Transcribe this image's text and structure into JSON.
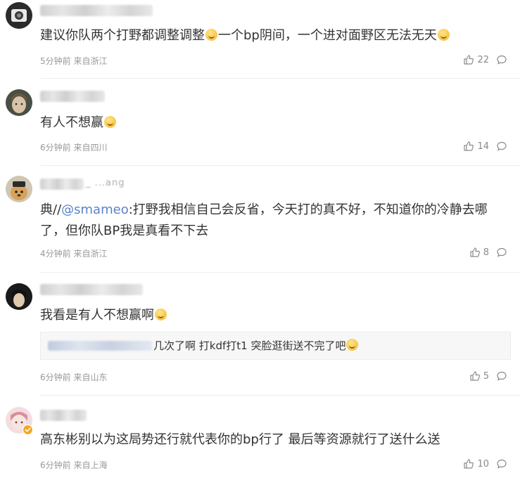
{
  "comments": [
    {
      "name_visible": "",
      "text": "建议你队两个打野都调整调整",
      "text_tail": "一个bp阴间，一个进对面野区无法无天",
      "time": "5分钟前",
      "location": "来自浙江",
      "likes": "22"
    },
    {
      "name_visible": "",
      "text": "有人不想赢",
      "time": "6分钟前",
      "location": "来自四川",
      "likes": "14"
    },
    {
      "name_visible": "_ ...ang",
      "text_prefix": "典//",
      "mention": "@smameo",
      "text": ":打野我相信自己会反省，今天打的真不好，不知道你的冷静去哪了，但你队BP我是真看不下去",
      "time": "4分钟前",
      "location": "来自浙江",
      "likes": "8"
    },
    {
      "name_visible": "",
      "text": "我看是有人不想赢啊",
      "reply": "几次了啊 打kdf打t1 突脸逛街送不完了吧",
      "time": "6分钟前",
      "location": "来自山东",
      "likes": "5"
    },
    {
      "name_visible": "",
      "text": "高东彬别以为这局势还行就代表你的bp行了 最后等资源就行了送什么送",
      "time": "6分钟前",
      "location": "来自上海",
      "likes": "10"
    }
  ],
  "icons": {
    "like": "thumbs-up-icon",
    "comment": "comment-bubble-icon",
    "verified": "verified-badge-icon"
  },
  "colors": {
    "mention": "#5a84c8",
    "meta": "#999999",
    "text": "#333333"
  }
}
